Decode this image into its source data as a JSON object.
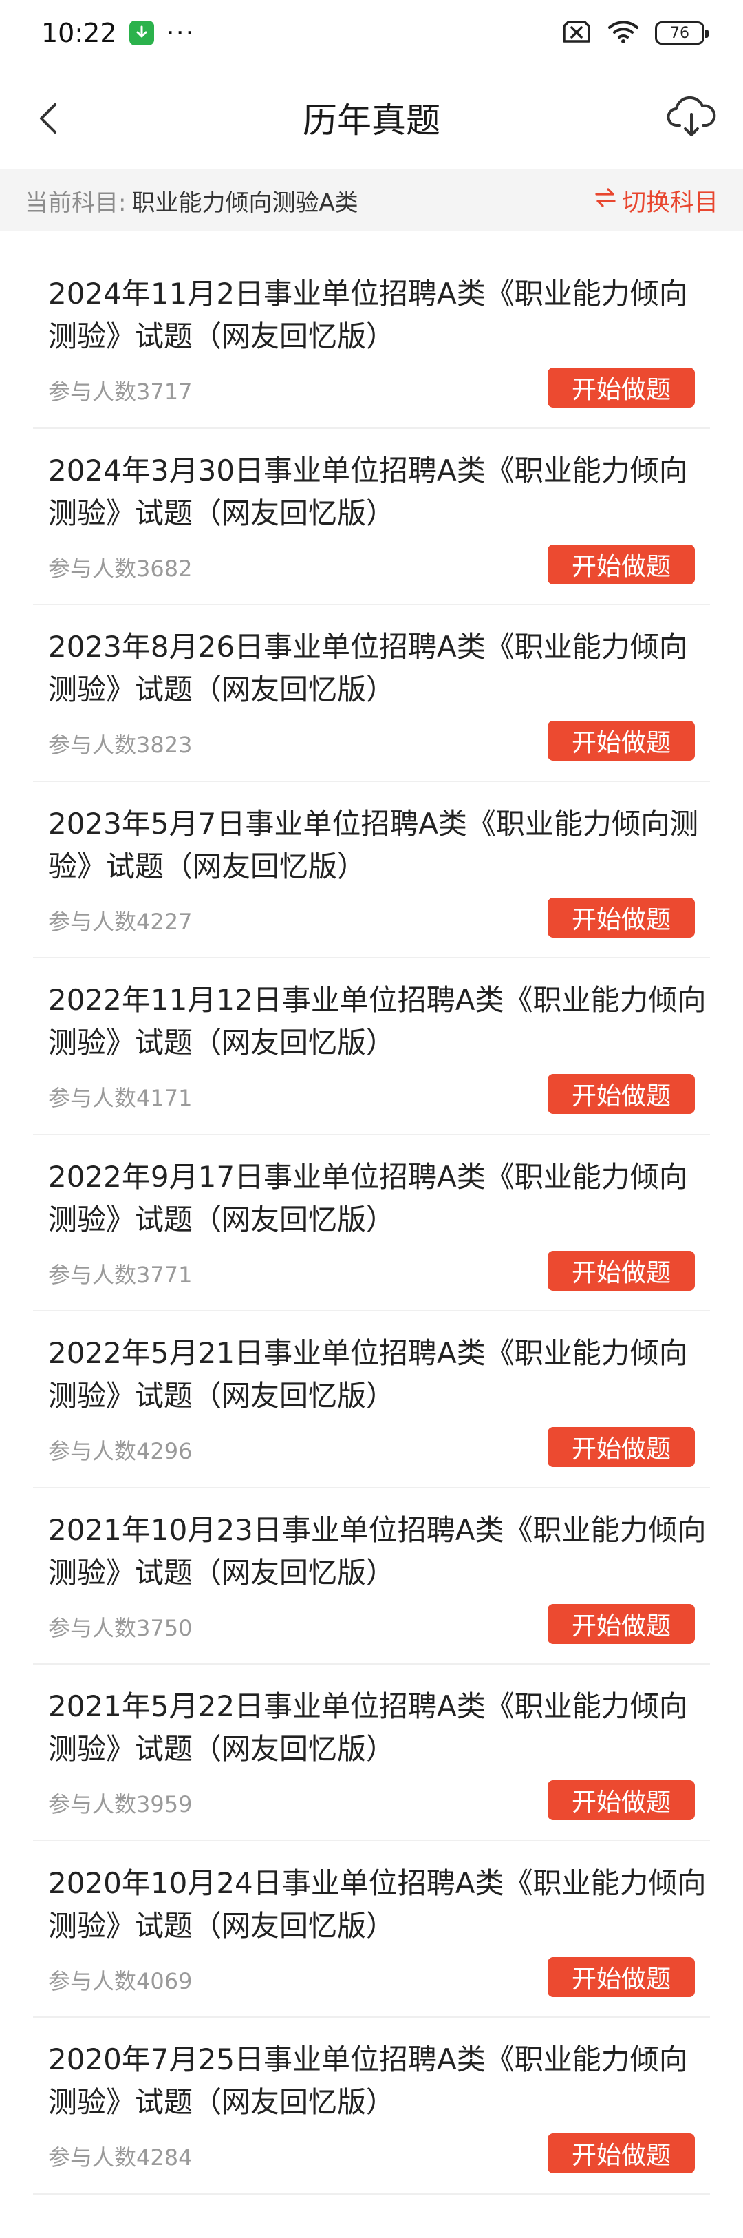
{
  "status": {
    "time": "10:22",
    "dots": "···",
    "battery": "76"
  },
  "header": {
    "title": "历年真题"
  },
  "subject": {
    "prefix": "当前科目:",
    "name": "职业能力倾向测验A类",
    "switch_label": "切换科目"
  },
  "colors": {
    "accent": "#ec4a30",
    "download_badge": "#2bb24c"
  },
  "exams": [
    {
      "title": "2024年11月2日事业单位招聘A类《职业能力倾向测验》试题（网友回忆版）",
      "count": "参与人数3717",
      "button": "开始做题"
    },
    {
      "title": "2024年3月30日事业单位招聘A类《职业能力倾向测验》试题（网友回忆版）",
      "count": "参与人数3682",
      "button": "开始做题"
    },
    {
      "title": "2023年8月26日事业单位招聘A类《职业能力倾向测验》试题（网友回忆版）",
      "count": "参与人数3823",
      "button": "开始做题"
    },
    {
      "title": "2023年5月7日事业单位招聘A类《职业能力倾向测验》试题（网友回忆版）",
      "count": "参与人数4227",
      "button": "开始做题"
    },
    {
      "title": "2022年11月12日事业单位招聘A类《职业能力倾向测验》试题（网友回忆版）",
      "count": "参与人数4171",
      "button": "开始做题"
    },
    {
      "title": "2022年9月17日事业单位招聘A类《职业能力倾向测验》试题（网友回忆版）",
      "count": "参与人数3771",
      "button": "开始做题"
    },
    {
      "title": "2022年5月21日事业单位招聘A类《职业能力倾向测验》试题（网友回忆版）",
      "count": "参与人数4296",
      "button": "开始做题"
    },
    {
      "title": "2021年10月23日事业单位招聘A类《职业能力倾向测验》试题（网友回忆版）",
      "count": "参与人数3750",
      "button": "开始做题"
    },
    {
      "title": "2021年5月22日事业单位招聘A类《职业能力倾向测验》试题（网友回忆版）",
      "count": "参与人数3959",
      "button": "开始做题"
    },
    {
      "title": "2020年10月24日事业单位招聘A类《职业能力倾向测验》试题（网友回忆版）",
      "count": "参与人数4069",
      "button": "开始做题"
    },
    {
      "title": "2020年7月25日事业单位招聘A类《职业能力倾向测验》试题（网友回忆版）",
      "count": "参与人数4284",
      "button": "开始做题"
    }
  ]
}
